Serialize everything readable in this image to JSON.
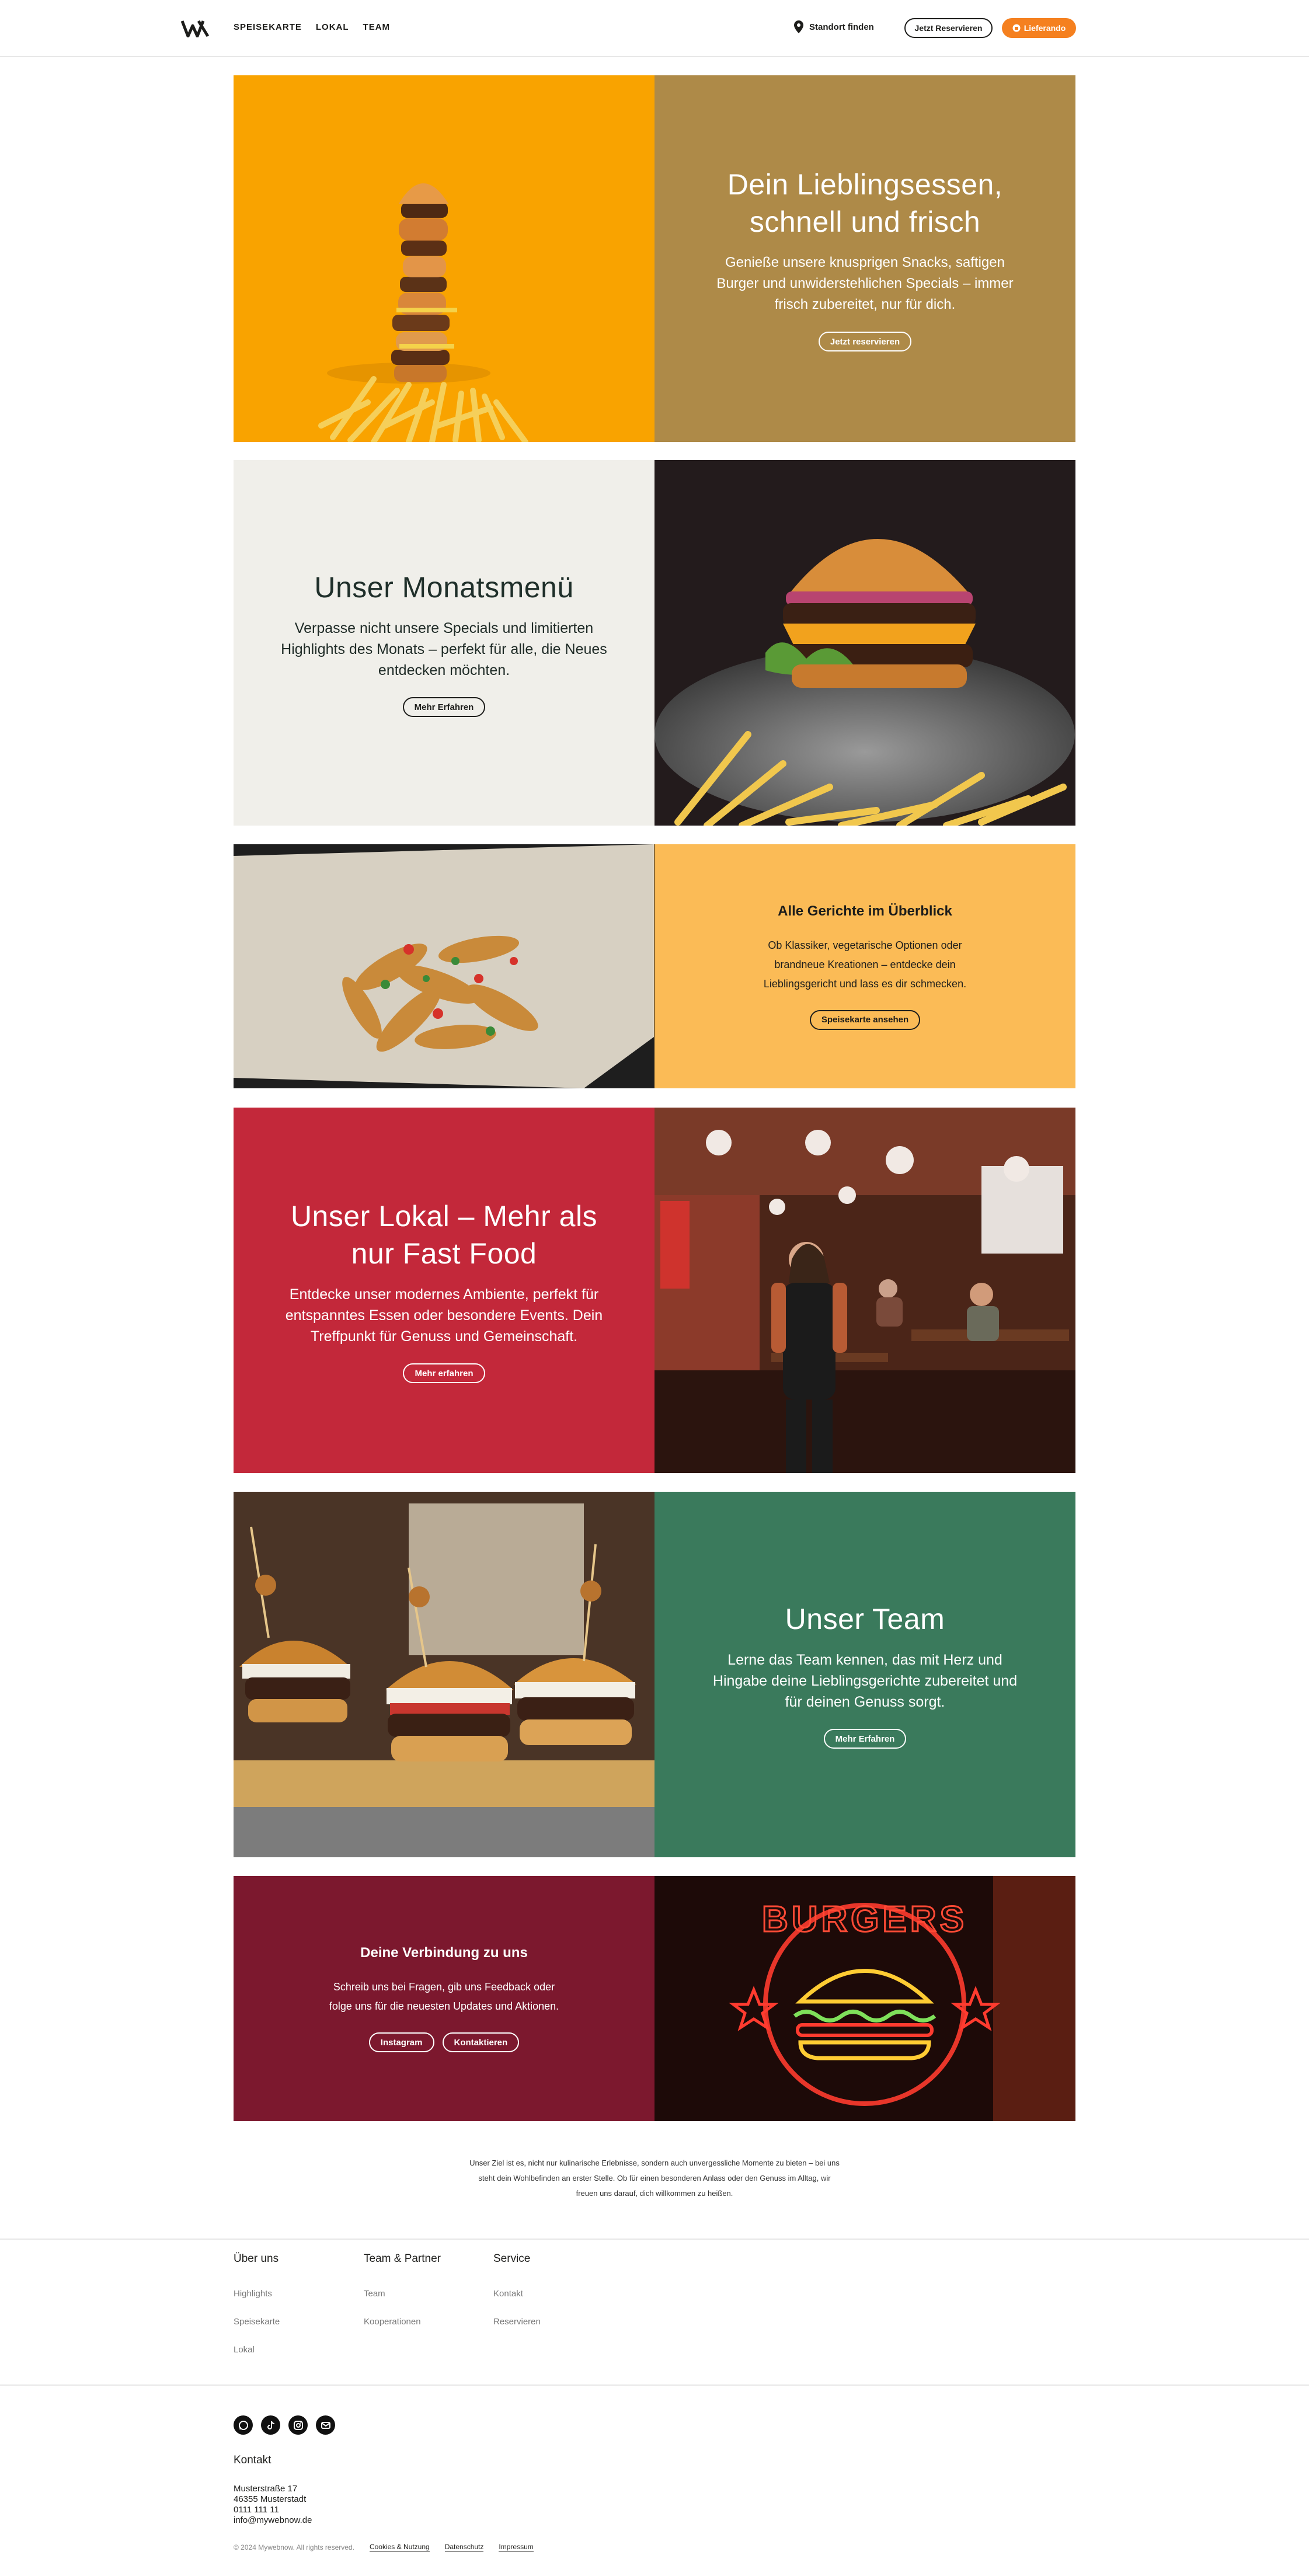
{
  "header": {
    "nav": [
      "SPEISEKARTE",
      "LOKAL",
      "TEAM"
    ],
    "standort": "Standort finden",
    "reserve_btn": "Jetzt Reservieren",
    "delivery_btn": "Lieferando"
  },
  "hero": {
    "title": "Dein Lieblingsessen, schnell und frisch",
    "text": "Genieße unsere knusprigen Snacks, saftigen Burger und unwiderstehlichen Specials – immer frisch zubereitet, nur für dich.",
    "button": "Jetzt reservieren"
  },
  "monatsmenu": {
    "title": "Unser Monatsmenü",
    "text": "Verpasse nicht unsere Specials und limitierten Highlights des Monats – perfekt für alle, die Neues entdecken möchten.",
    "button": "Mehr Erfahren"
  },
  "gerichte": {
    "title": "Alle Gerichte im Überblick",
    "text": "Ob Klassiker, vegetarische Optionen oder brandneue Kreationen – entdecke dein Lieblingsgericht und lass es dir schmecken.",
    "button": "Speisekarte ansehen"
  },
  "lokal": {
    "title": "Unser Lokal – Mehr als nur Fast Food",
    "text": "Entdecke unser modernes Ambiente, perfekt für entspanntes Essen oder besondere Events. Dein Treffpunkt für Genuss und Gemeinschaft.",
    "button": "Mehr erfahren"
  },
  "team": {
    "title": "Unser Team",
    "text": "Lerne das Team kennen, das mit Herz und Hingabe deine Lieblingsgerichte zubereitet und für deinen Genuss sorgt.",
    "button": "Mehr Erfahren"
  },
  "verbindung": {
    "title": "Deine Verbindung zu uns",
    "text": "Schreib uns bei Fragen, gib uns Feedback oder folge uns für die neuesten Updates und Aktionen.",
    "btn_instagram": "Instagram",
    "btn_kontakt": "Kontaktieren",
    "neon": "BURGERS"
  },
  "summary": "Unser Ziel ist es, nicht nur kulinarische Erlebnisse, sondern auch unvergessliche Momente zu bieten – bei uns steht dein Wohlbefinden an erster Stelle. Ob für einen besonderen Anlass oder den Genuss im Alltag, wir freuen uns darauf, dich willkommen zu heißen.",
  "footer": {
    "col1": {
      "title": "Über uns",
      "links": [
        "Highlights",
        "Speisekarte",
        "Lokal"
      ]
    },
    "col2": {
      "title": "Team & Partner",
      "links": [
        "Team",
        "Kooperationen"
      ]
    },
    "col3": {
      "title": "Service",
      "links": [
        "Kontakt",
        "Reservieren"
      ]
    },
    "kontakt_title": "Kontakt",
    "address": [
      "Musterstraße 17",
      "46355 Musterstadt",
      "0111 111 11",
      "info@mywebnow.de"
    ],
    "copyright": "© 2024 Mywebnow. All rights reserved.",
    "legal": [
      "Cookies & Nutzung",
      "Datenschutz",
      "Impressum"
    ]
  },
  "colors": {
    "orange": "#f9a300",
    "gold": "#ae8a48",
    "cream": "#f0efea",
    "yellow": "#fbbb56",
    "red": "#c3283a",
    "green": "#3a7a5c",
    "wine": "#7c182e",
    "accent": "#f5801f"
  }
}
